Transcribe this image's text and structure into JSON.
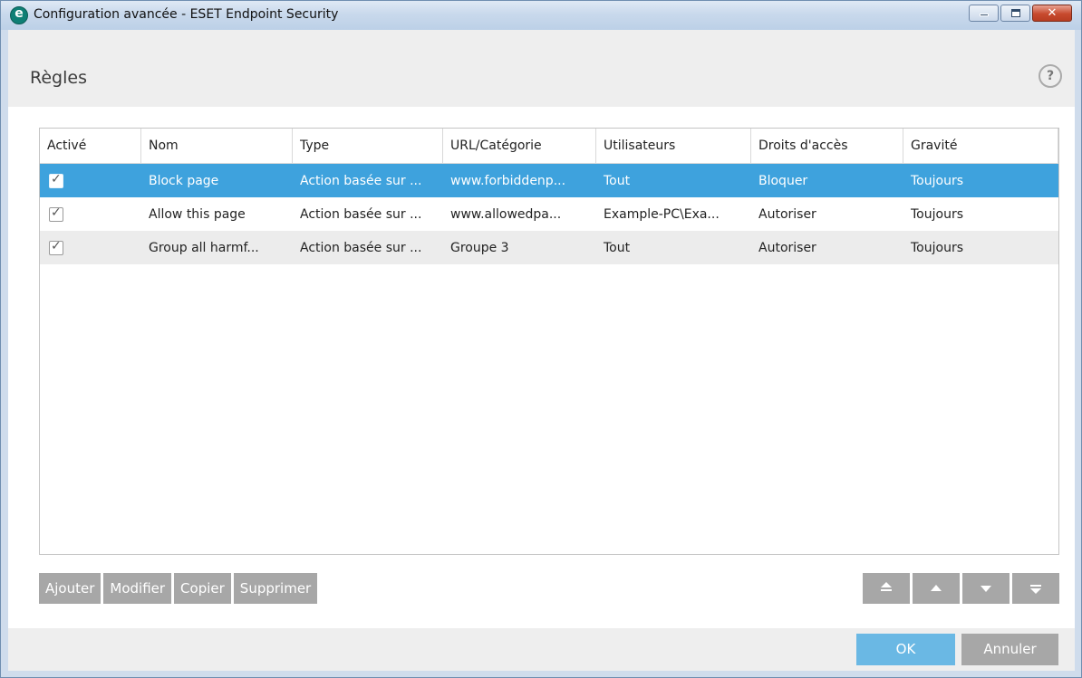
{
  "window": {
    "title": "Configuration avancée - ESET Endpoint Security",
    "logo_icon": "eset-e-logo-icon",
    "controls": [
      "minimize-icon",
      "maximize-icon",
      "close-icon"
    ]
  },
  "header": {
    "title": "Règles",
    "help_label": "?"
  },
  "table": {
    "columns": [
      "Activé",
      "Nom",
      "Type",
      "URL/Catégorie",
      "Utilisateurs",
      "Droits d'accès",
      "Gravité"
    ],
    "rows": [
      {
        "enabled": true,
        "name": "Block page",
        "type": "Action basée sur ...",
        "url": "www.forbiddenp...",
        "users": "Tout",
        "rights": "Bloquer",
        "severity": "Toujours",
        "selected": true
      },
      {
        "enabled": true,
        "name": "Allow this page",
        "type": "Action basée sur ...",
        "url": "www.allowedpa...",
        "users": "Example-PC\\Exa...",
        "rights": "Autoriser",
        "severity": "Toujours",
        "selected": false
      },
      {
        "enabled": true,
        "name": "Group all harmf...",
        "type": "Action basée sur ...",
        "url": "Groupe 3",
        "users": "Tout",
        "rights": "Autoriser",
        "severity": "Toujours",
        "selected": false
      }
    ]
  },
  "actions": {
    "add": "Ajouter",
    "edit": "Modifier",
    "copy": "Copier",
    "delete": "Supprimer"
  },
  "move_buttons": [
    "move-top-icon",
    "move-up-icon",
    "move-down-icon",
    "move-bottom-icon"
  ],
  "footer": {
    "ok": "OK",
    "cancel": "Annuler"
  },
  "colors": {
    "selection": "#3ea2dd",
    "button_gray": "#a7a7a7",
    "ok_blue": "#6ab8e4",
    "header_bg": "#eeeeee"
  }
}
